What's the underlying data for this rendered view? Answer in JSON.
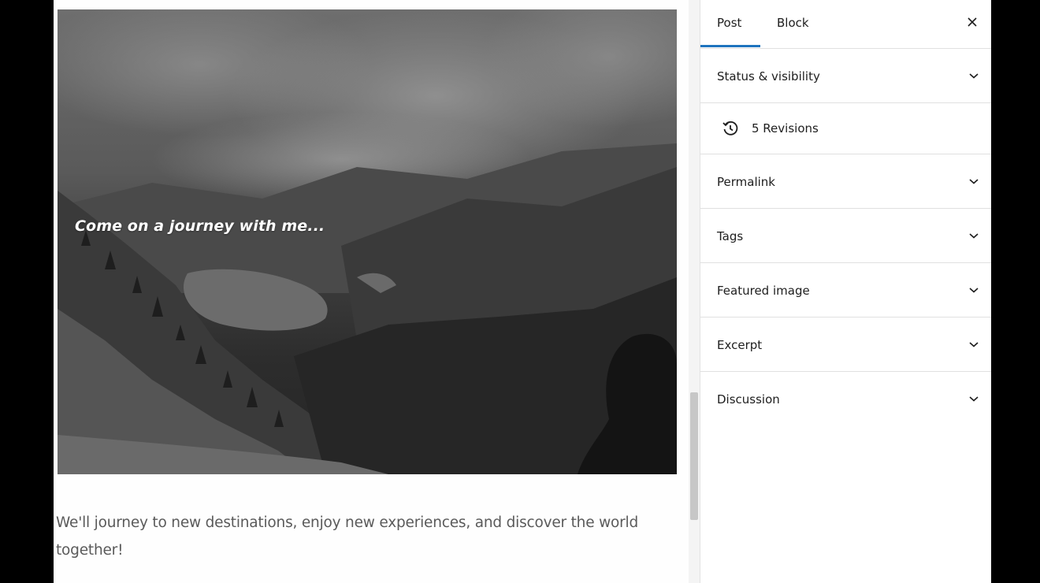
{
  "editor": {
    "cover_heading": "Come on a journey with me...",
    "paragraph": "We'll journey to new destinations, enjoy new experiences, and discover the world together!"
  },
  "sidebar": {
    "tabs": [
      {
        "label": "Post",
        "active": true
      },
      {
        "label": "Block",
        "active": false
      }
    ],
    "close_icon": "close-icon",
    "accent_color": "#1e73be",
    "panels": {
      "status_visibility": "Status & visibility",
      "revisions": "5 Revisions",
      "permalink": "Permalink",
      "tags": "Tags",
      "featured_image": "Featured image",
      "excerpt": "Excerpt",
      "discussion": "Discussion"
    }
  }
}
